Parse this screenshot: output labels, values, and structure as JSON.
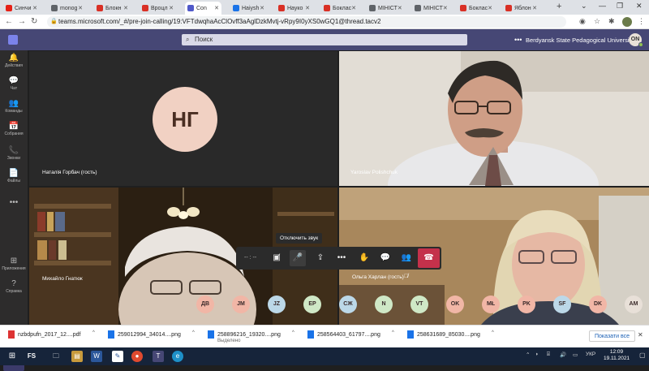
{
  "browser": {
    "tabs": [
      {
        "label": "Синчи",
        "color": "#e62117"
      },
      {
        "label": "monog",
        "color": "#5f6368"
      },
      {
        "label": "Блокн",
        "color": "#d93025"
      },
      {
        "label": "Вроцл",
        "color": "#d93025"
      },
      {
        "label": "Con",
        "color": "#5059c9",
        "active": true
      },
      {
        "label": "Haiysh",
        "color": "#1a73e8"
      },
      {
        "label": "Науко",
        "color": "#d93025"
      },
      {
        "label": "Боклас",
        "color": "#d93025"
      },
      {
        "label": "МІНІСТ",
        "color": "#5f6368"
      },
      {
        "label": "МІНІСТ",
        "color": "#5f6368"
      },
      {
        "label": "Боклас",
        "color": "#d93025"
      },
      {
        "label": "Яблон",
        "color": "#d93025"
      }
    ],
    "url": "teams.microsoft.com/_#/pre-join-calling/19:VFTdwqhaAcClOvff3aAglDzkMvtj-vRpy9I0yXS0wGQ1@thread.tacv2"
  },
  "teams": {
    "search_placeholder": "Поиск",
    "org_name": "Berdyansk State Pedagogical University",
    "avatar_initials": "ON"
  },
  "rail": [
    {
      "icon": "bell-icon",
      "glyph": "🔔",
      "label": "Действия"
    },
    {
      "icon": "chat-icon",
      "glyph": "💬",
      "label": "Чат"
    },
    {
      "icon": "teams-icon",
      "glyph": "👥",
      "label": "Команды"
    },
    {
      "icon": "calendar-icon",
      "glyph": "📅",
      "label": "Собрания"
    },
    {
      "icon": "calls-icon",
      "glyph": "📞",
      "label": "Звонки"
    },
    {
      "icon": "files-icon",
      "glyph": "📄",
      "label": "Файлы"
    },
    {
      "icon": "more-icon",
      "glyph": "•••",
      "label": ""
    },
    {
      "icon": "apps-icon",
      "glyph": "⊞",
      "label": "Приложения"
    },
    {
      "icon": "help-icon",
      "glyph": "?",
      "label": "Справка"
    }
  ],
  "participants": {
    "tile1": {
      "name": "Наталія Горбач (гость)",
      "initials": "НГ"
    },
    "tile2": {
      "name": "Yaroslav Polishchuk"
    },
    "tile3": {
      "name": "Михайло Гнатюк"
    },
    "tile4": {
      "name": "Ольга Харлан (гость)"
    }
  },
  "controls": {
    "timer": "-- : --",
    "tooltip": "Отключить звук"
  },
  "chips": [
    {
      "label": "ДВ",
      "color": "#f1b6a6"
    },
    {
      "label": "JM",
      "color": "#f1b6a6"
    },
    {
      "label": "JZ",
      "color": "#bcd8e8"
    },
    {
      "label": "EP",
      "color": "#cfe8c6"
    },
    {
      "label": "СЖ",
      "color": "#bcd8e8"
    },
    {
      "label": "N",
      "color": "#cfe8c6"
    },
    {
      "label": "VT",
      "color": "#cfe8c6"
    },
    {
      "label": "OK",
      "color": "#f1b6a6"
    },
    {
      "label": "МŁ",
      "color": "#f1b6a6"
    },
    {
      "label": "PK",
      "color": "#f1b6a6"
    },
    {
      "label": "SF",
      "color": "#bcd8e8"
    },
    {
      "label": "DK",
      "color": "#f1b6a6"
    },
    {
      "label": "AM",
      "color": "#e8e0d8"
    }
  ],
  "downloads": [
    {
      "name": "nzbdpufn_2017_12....pdf",
      "sub": "",
      "type": "pdf"
    },
    {
      "name": "259012994_34014....png",
      "sub": "",
      "type": "png"
    },
    {
      "name": "258896216_19320....png",
      "sub": "Выделено",
      "type": "png"
    },
    {
      "name": "258564403_61797....png",
      "sub": "",
      "type": "png"
    },
    {
      "name": "258631689_85030....png",
      "sub": "",
      "type": "png"
    }
  ],
  "show_all_label": "Показати все",
  "taskbar": {
    "fs_label": "FS",
    "lang": "УКР",
    "time": "12:09",
    "date": "19.11.2021"
  }
}
